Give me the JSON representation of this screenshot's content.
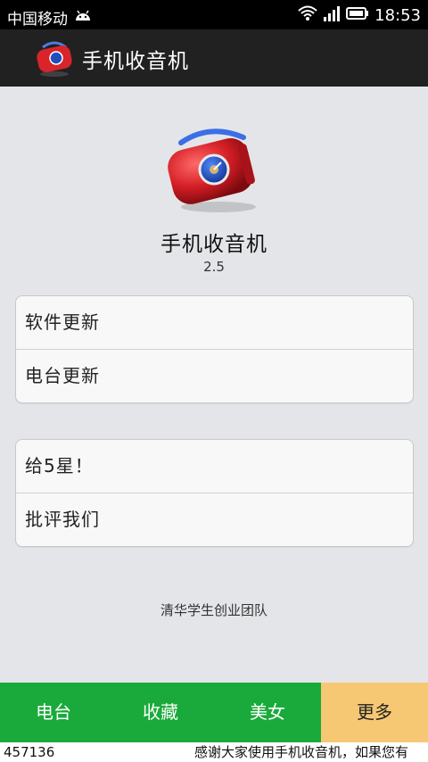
{
  "status_bar": {
    "carrier": "中国移动",
    "time": "18:53"
  },
  "action_bar": {
    "title": "手机收音机"
  },
  "about": {
    "app_name": "手机收音机",
    "version": "2.5"
  },
  "menu_group_1": [
    {
      "label": "软件更新"
    },
    {
      "label": "电台更新"
    }
  ],
  "menu_group_2": [
    {
      "label": "给5星！"
    },
    {
      "label": "批评我们"
    }
  ],
  "footer": {
    "team": "清华学生创业团队"
  },
  "tabs": [
    {
      "label": "电台",
      "active": false
    },
    {
      "label": "收藏",
      "active": false
    },
    {
      "label": "美女",
      "active": false
    },
    {
      "label": "更多",
      "active": true
    }
  ],
  "ticker": {
    "left": "457136",
    "message": "感谢大家使用手机收音机，如果您有"
  },
  "colors": {
    "tab_green": "#1aaa3b",
    "tab_active": "#f7c873",
    "action_bar": "#212121"
  }
}
